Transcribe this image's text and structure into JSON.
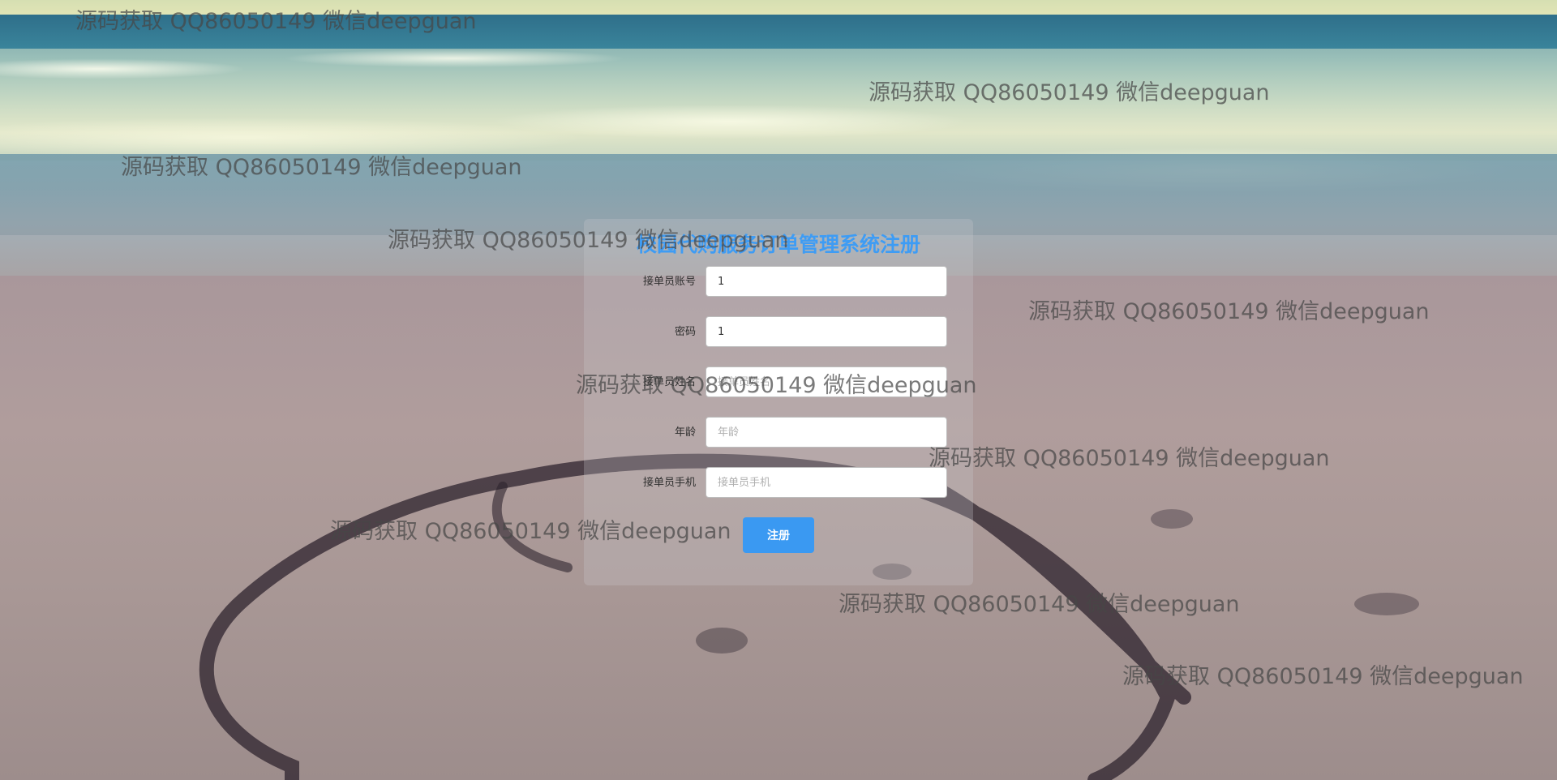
{
  "page": {
    "title": "校园代购服务订单管理系统注册"
  },
  "form": {
    "fields": [
      {
        "label": "接单员账号",
        "value": "1",
        "placeholder": ""
      },
      {
        "label": "密码",
        "value": "1",
        "placeholder": ""
      },
      {
        "label": "接单员姓名",
        "value": "",
        "placeholder": "接单员姓名"
      },
      {
        "label": "年龄",
        "value": "",
        "placeholder": "年龄"
      },
      {
        "label": "接单员手机",
        "value": "",
        "placeholder": "接单员手机"
      }
    ],
    "submit_label": "注册"
  },
  "watermark": {
    "text": "源码获取 QQ86050149 微信deepguan"
  },
  "colors": {
    "accent": "#3a99f2",
    "title": "#3e9cf4"
  }
}
